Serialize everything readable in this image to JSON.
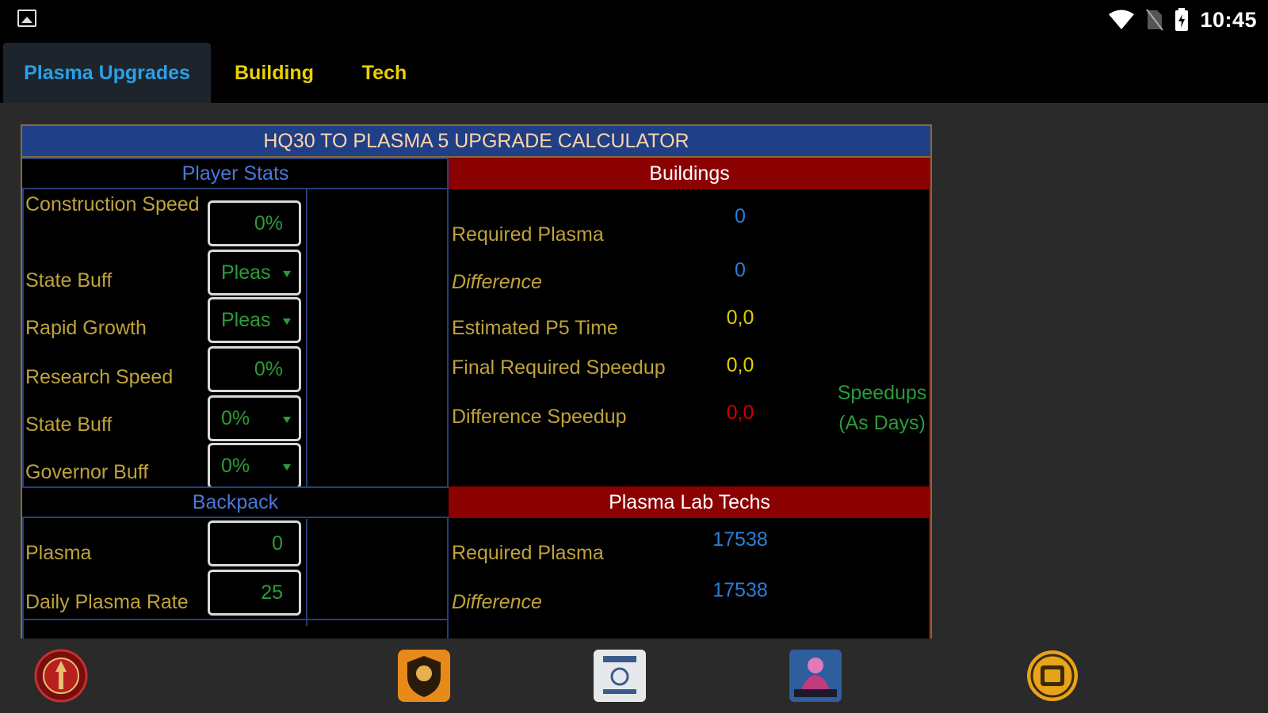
{
  "status_bar": {
    "time": "10:45"
  },
  "tabs": [
    {
      "label": "Plasma Upgrades",
      "color": "#2aa0e8"
    },
    {
      "label": "Building",
      "color": "#e8d000"
    },
    {
      "label": "Tech",
      "color": "#e8d000"
    }
  ],
  "calculator": {
    "title": "HQ30 TO PLASMA 5 UPGRADE CALCULATOR",
    "player_stats": {
      "heading": "Player Stats",
      "construction_speed_label": "Construction Speed",
      "construction_speed_value": "0%",
      "state_buff_label": "State Buff",
      "state_buff_value": "Pleas",
      "rapid_growth_label": "Rapid Growth",
      "rapid_growth_value": "Pleas",
      "research_speed_label": "Research Speed",
      "research_speed_value": "0%",
      "state_buff2_label": "State Buff",
      "state_buff2_value": "0%",
      "governor_buff_label": "Governor Buff",
      "governor_buff_value": "0%"
    },
    "backpack": {
      "heading": "Backpack",
      "plasma_label": "Plasma",
      "plasma_value": "0",
      "daily_rate_label": "Daily Plasma Rate",
      "daily_rate_value": "25"
    },
    "buildings": {
      "heading": "Buildings",
      "required_plasma_label": "Required Plasma",
      "required_plasma_value": "0",
      "difference_label": "Difference",
      "difference_value": "0",
      "estimated_time_label": "Estimated P5 Time",
      "estimated_time_value": "0,0",
      "final_speedup_label": "Final Required Speedup",
      "final_speedup_value": "0,0",
      "difference_speedup_label": "Difference Speedup",
      "difference_speedup_value": "0,0",
      "speedups_note": "Speedups (As Days)"
    },
    "plasma_lab_techs": {
      "heading": "Plasma Lab Techs",
      "required_plasma_label": "Required Plasma",
      "required_plasma_value": "17538",
      "difference_label": "Difference",
      "difference_value": "17538"
    }
  },
  "bottom_nav": {
    "icons": [
      "emblem-icon",
      "shield-badge-icon",
      "document-icon",
      "character-icon",
      "col-lab-icon"
    ]
  }
}
